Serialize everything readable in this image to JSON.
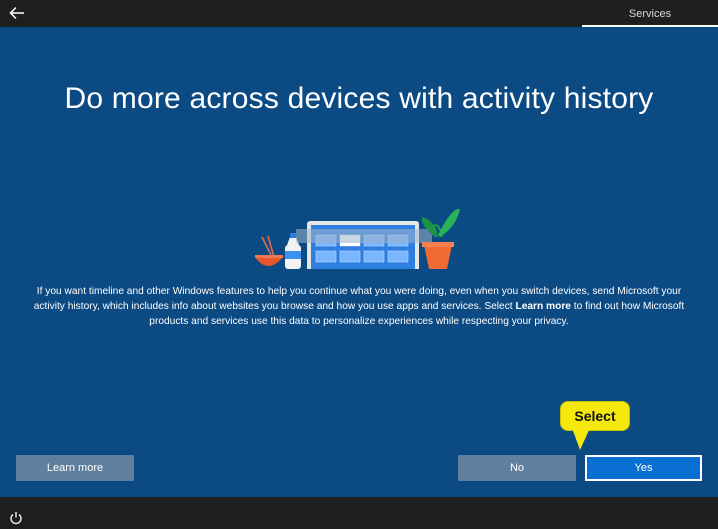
{
  "header": {
    "section_label": "Services"
  },
  "main": {
    "title": "Do more across devices with activity history",
    "description": {
      "part1": "If you want timeline and other Windows features to help you continue what you were doing, even when you switch devices, send Microsoft your activity history, which includes info about websites you browse and how you use apps and services. Select ",
      "link": "Learn more",
      "part2": " to find out how Microsoft products and services use this data to personalize experiences while respecting your privacy."
    }
  },
  "buttons": {
    "learn_more": "Learn more",
    "no": "No",
    "yes": "Yes"
  },
  "callout": {
    "label": "Select"
  },
  "icons": {
    "back": "back-arrow-icon",
    "power": "power-icon"
  },
  "colors": {
    "background": "#0c4a83",
    "bars": "#1f1f1f",
    "secondary_button": "#5f7f9f",
    "primary_button": "#0a6fd3",
    "callout": "#f5e80d"
  }
}
